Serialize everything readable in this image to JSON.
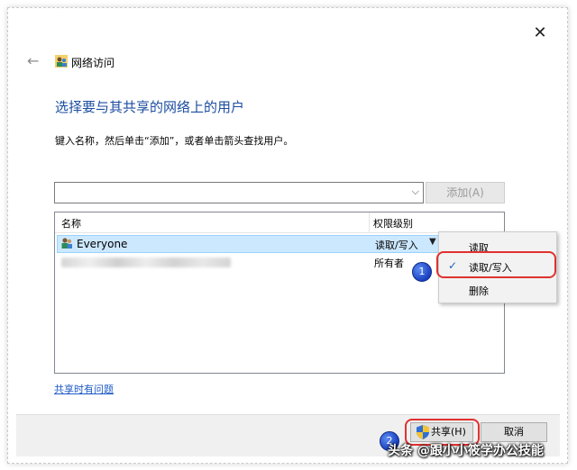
{
  "window": {
    "title": "网络访问",
    "close_glyph": "✕",
    "back_glyph": "←"
  },
  "main": {
    "heading": "选择要与其共享的网络上的用户",
    "instruction": "键入名称，然后单击“添加”，或者单击箭头查找用户。",
    "name_input": {
      "value": "",
      "placeholder": ""
    },
    "add_button": "添加(A)"
  },
  "user_list": {
    "columns": [
      "名称",
      "权限级别"
    ],
    "rows": [
      {
        "name": "Everyone",
        "permission": "读取/写入",
        "selected": true
      },
      {
        "name": "",
        "permission": "所有者",
        "selected": false
      }
    ]
  },
  "context_menu": {
    "items": [
      {
        "label": "读取",
        "checked": false
      },
      {
        "label": "读取/写入",
        "checked": true
      },
      {
        "label": "删除",
        "checked": false
      }
    ]
  },
  "annotations": {
    "badge1": "1",
    "badge2": "2",
    "highlight_color": "#e0312f"
  },
  "links": {
    "trouble": "共享时有问题"
  },
  "footer": {
    "share_button": "共享(H)",
    "cancel_button": "取消"
  },
  "watermark": "头条 @跟小小筱学办公技能",
  "colors": {
    "heading": "#1c4da0",
    "link": "#1c58c4",
    "selection": "#cce8ff"
  },
  "icons": [
    "back-arrow-icon",
    "users-icon",
    "close-icon",
    "chevron-down-icon",
    "checkmark-icon",
    "shield-icon"
  ]
}
